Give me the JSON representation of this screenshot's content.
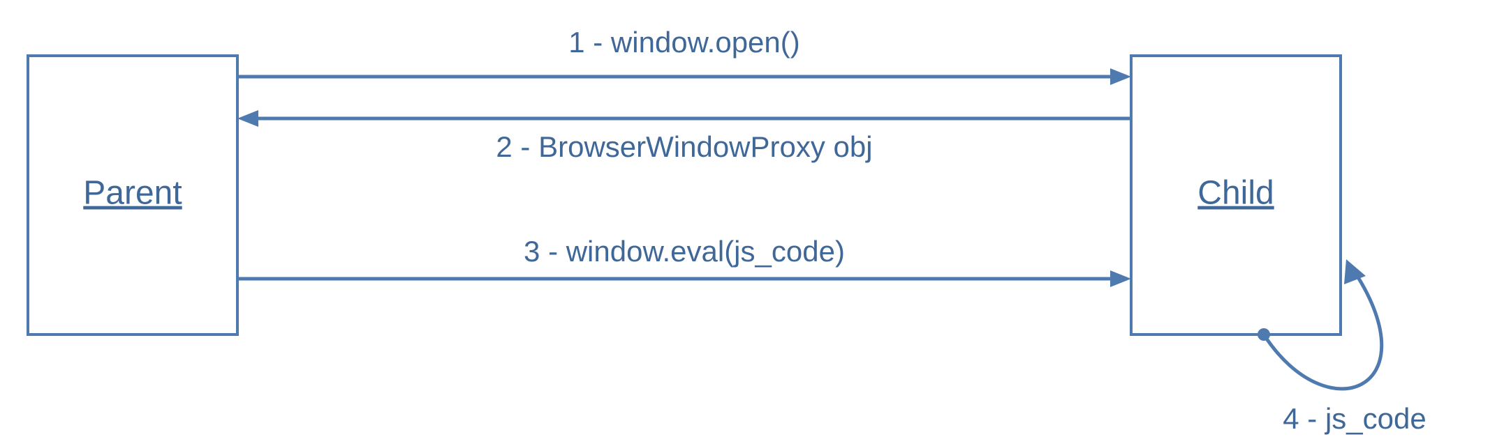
{
  "nodes": {
    "parent": {
      "label": "Parent"
    },
    "child": {
      "label": "Child"
    }
  },
  "edges": {
    "e1": {
      "label": "1 - window.open()"
    },
    "e2": {
      "label": "2 - BrowserWindowProxy obj"
    },
    "e3": {
      "label": "3 - window.eval(js_code)"
    },
    "e4": {
      "label": "4 - js_code"
    }
  },
  "colors": {
    "line": "#4f7ab0",
    "text": "#3f6798"
  }
}
